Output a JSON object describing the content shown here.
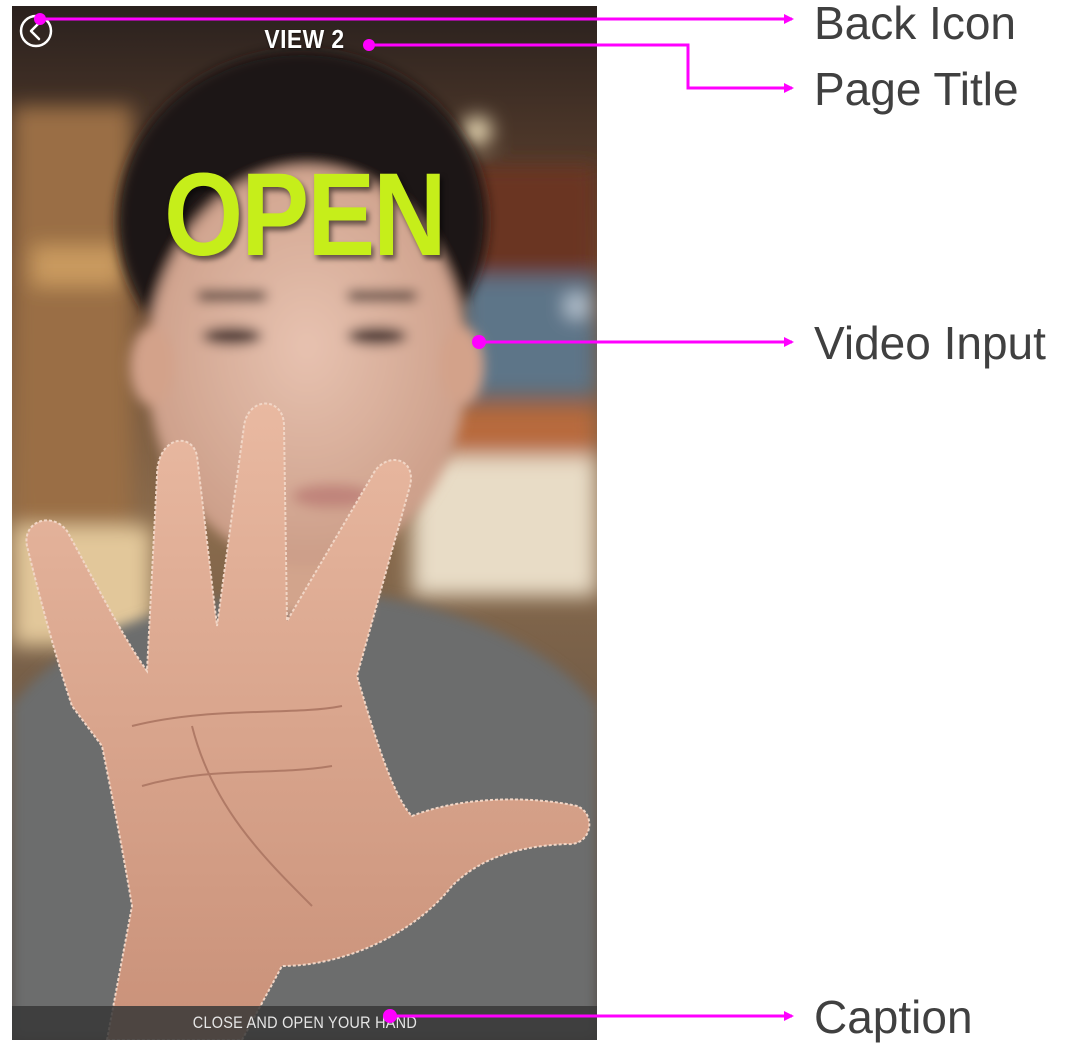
{
  "screen": {
    "title": "VIEW 2",
    "gesture_word": "OPEN",
    "caption": "CLOSE AND OPEN YOUR HAND",
    "back_icon": "chevron-left-circle-icon",
    "accent_color": "#c6ee1a"
  },
  "annotations": {
    "color": "#ff00ff",
    "labels": [
      "Back Icon",
      "Page Title",
      "Video Input",
      "Caption"
    ]
  }
}
